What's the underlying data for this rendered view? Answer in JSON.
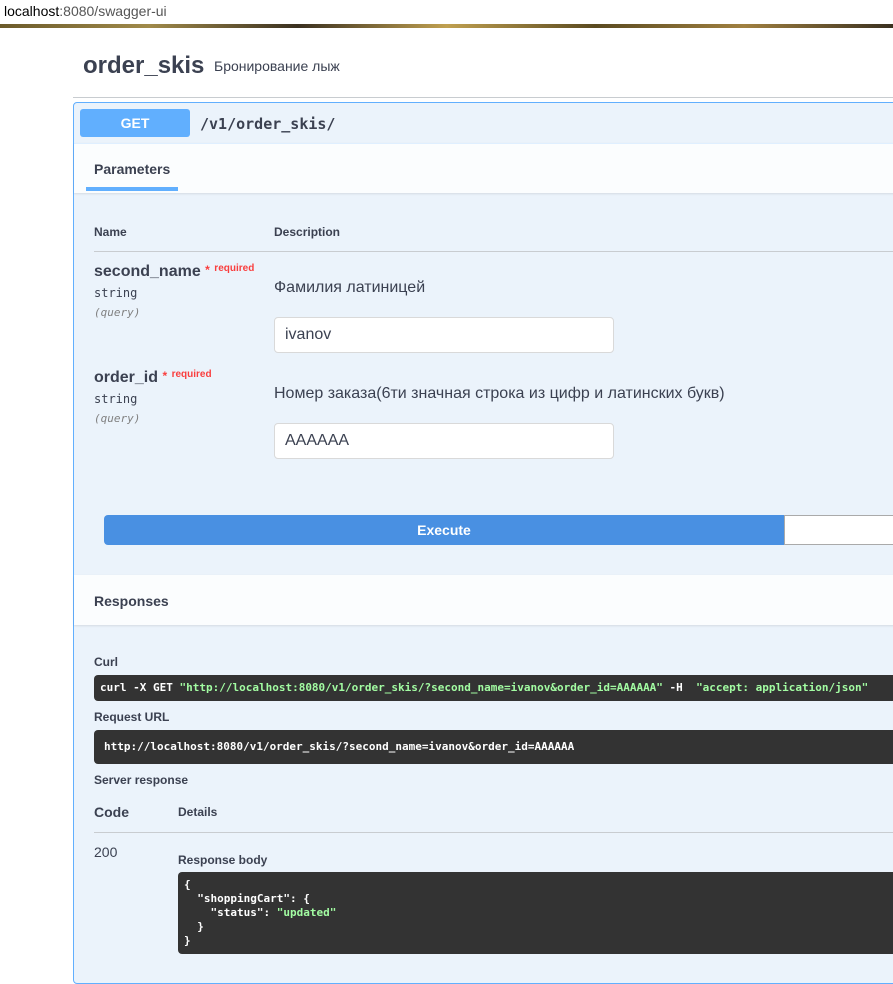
{
  "browser": {
    "url_host": "localhost",
    "url_rest": ":8080/swagger-ui"
  },
  "header": {
    "title": "order_skis",
    "subtitle": "Бронирование лыж"
  },
  "operation": {
    "method": "GET",
    "path": "/v1/order_skis/"
  },
  "parameters": {
    "tab_label": "Parameters",
    "col_name": "Name",
    "col_description": "Description",
    "required_label": "required",
    "items": [
      {
        "name": "second_name",
        "type": "string",
        "in": "(query)",
        "description": "Фамилия латиницей",
        "value": "ivanov"
      },
      {
        "name": "order_id",
        "type": "string",
        "in": "(query)",
        "description": "Номер заказа(6ти значная строка из цифр и латинских букв)",
        "value": "AAAAAA"
      }
    ]
  },
  "execute_label": "Execute",
  "responses": {
    "title": "Responses",
    "curl_label": "Curl",
    "curl_cmd_prefix": "curl -X GET ",
    "curl_url": "\"http://localhost:8080/v1/order_skis/?second_name=ivanov&order_id=AAAAAA\"",
    "curl_flag": " -H  ",
    "curl_header": "\"accept: application/json\"",
    "request_url_label": "Request URL",
    "request_url": "http://localhost:8080/v1/order_skis/?second_name=ivanov&order_id=AAAAAA",
    "server_response_label": "Server response",
    "col_code": "Code",
    "col_details": "Details",
    "code": "200",
    "response_body_label": "Response body",
    "body": {
      "open": "{",
      "key1": "\"shoppingCart\"",
      "sep1": ": {",
      "key2": "\"status\"",
      "sep2": ": ",
      "val2": "\"updated\"",
      "close_inner": "}",
      "close": "}"
    }
  },
  "colors": {
    "get": "#61affe",
    "execute": "#4990e2",
    "required": "#f93e3e"
  }
}
